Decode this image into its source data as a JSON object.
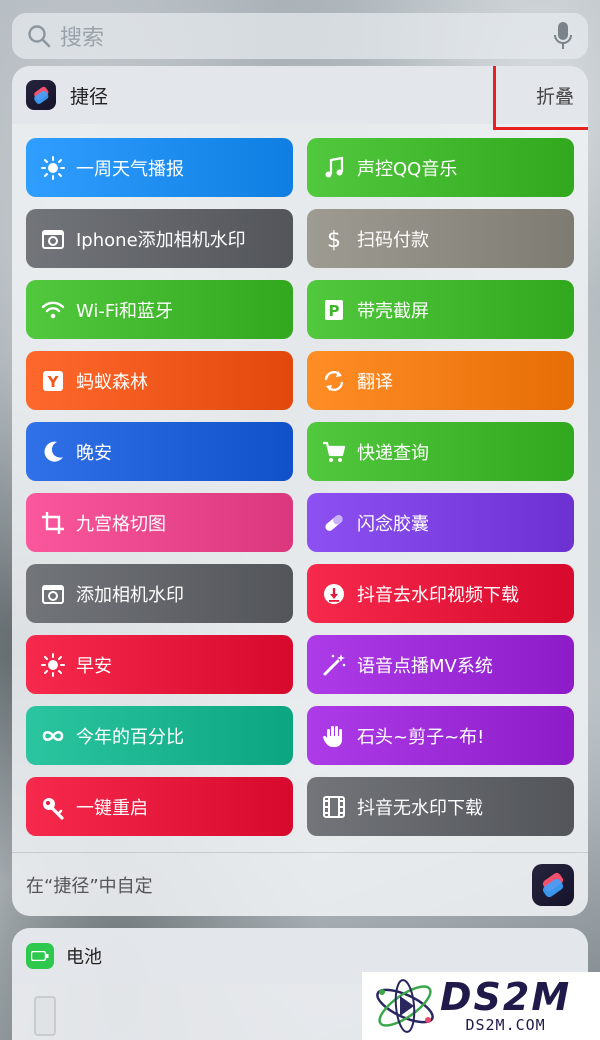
{
  "search": {
    "placeholder": "搜索"
  },
  "widget": {
    "title": "捷径",
    "collapse_label": "折叠",
    "footer_text": "在“捷径”中自定",
    "shortcuts": [
      {
        "label": "一周天气播报",
        "icon": "sun-icon",
        "color": "#1d8cf0"
      },
      {
        "label": "声控QQ音乐",
        "icon": "music-note-icon",
        "color": "#3fb62b"
      },
      {
        "label": "Iphone添加相机水印",
        "icon": "camera-icon",
        "color": "#606368"
      },
      {
        "label": "扫码付款",
        "icon": "dollar-icon",
        "color": "#8c8a80"
      },
      {
        "label": "Wi-Fi和蓝牙",
        "icon": "wifi-icon",
        "color": "#3fb62b"
      },
      {
        "label": "带壳截屏",
        "icon": "p-icon",
        "color": "#3fb62b"
      },
      {
        "label": "蚂蚁森林",
        "icon": "y-icon",
        "color": "#f0561a"
      },
      {
        "label": "翻译",
        "icon": "refresh-icon",
        "color": "#f57b14"
      },
      {
        "label": "晚安",
        "icon": "moon-icon",
        "color": "#1f5fd6"
      },
      {
        "label": "快递查询",
        "icon": "cart-icon",
        "color": "#3fb62b"
      },
      {
        "label": "九宫格切图",
        "icon": "crop-icon",
        "color": "#e8458b"
      },
      {
        "label": "闪念胶囊",
        "icon": "pill-icon",
        "color": "#7b3fe0"
      },
      {
        "label": "添加相机水印",
        "icon": "camera-icon",
        "color": "#606368"
      },
      {
        "label": "抖音去水印视频下载",
        "icon": "download-icon",
        "color": "#e5173a"
      },
      {
        "label": "早安",
        "icon": "sun-icon",
        "color": "#e5173a"
      },
      {
        "label": "语音点播MV系统",
        "icon": "magic-wand-icon",
        "color": "#9b2ad6"
      },
      {
        "label": "今年的百分比",
        "icon": "infinity-icon",
        "color": "#19b38e"
      },
      {
        "label": "石头~剪子~布!",
        "icon": "hand-icon",
        "color": "#9b2ad6"
      },
      {
        "label": "一键重启",
        "icon": "key-icon",
        "color": "#e5173a"
      },
      {
        "label": "抖音无水印下载",
        "icon": "film-icon",
        "color": "#606368"
      }
    ]
  },
  "battery": {
    "title": "电池"
  },
  "watermark": {
    "big": "DS2M",
    "small": "DS2M.COM"
  }
}
